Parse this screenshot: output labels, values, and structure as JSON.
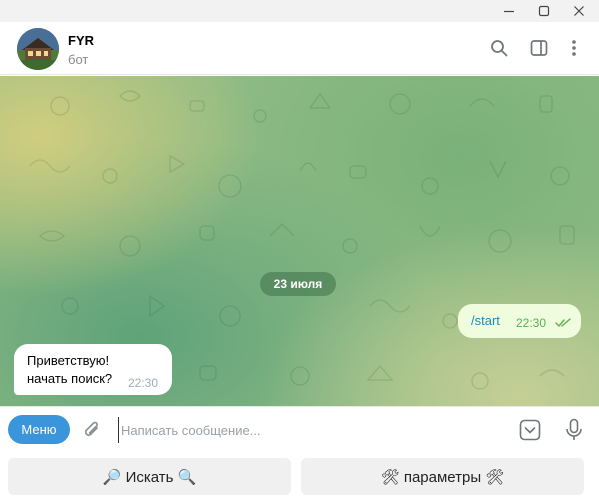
{
  "window": {
    "controls": [
      "minimize",
      "maximize",
      "close"
    ]
  },
  "chat": {
    "title": "FYR",
    "subtitle": "бот",
    "avatar_icon": "house-avatar"
  },
  "header_actions": [
    "search-icon",
    "sidebar-icon",
    "more-icon"
  ],
  "messages": {
    "date_label": "23 июля",
    "outgoing": {
      "text": "/start",
      "time": "22:30",
      "status": "read"
    },
    "incoming": {
      "line1": "Приветствую!",
      "line2": "начать поиск?",
      "time": "22:30"
    }
  },
  "composer": {
    "menu_label": "Меню",
    "placeholder": "Написать сообщение...",
    "value": ""
  },
  "reply_keyboard": {
    "search_label": "🔎 Искать 🔍",
    "params_label": "🛠 параметры 🛠"
  },
  "colors": {
    "accent": "#3a95db",
    "outgoing_bubble": "#effdde",
    "outgoing_text": "#168acd",
    "check_color": "#5fae53"
  }
}
